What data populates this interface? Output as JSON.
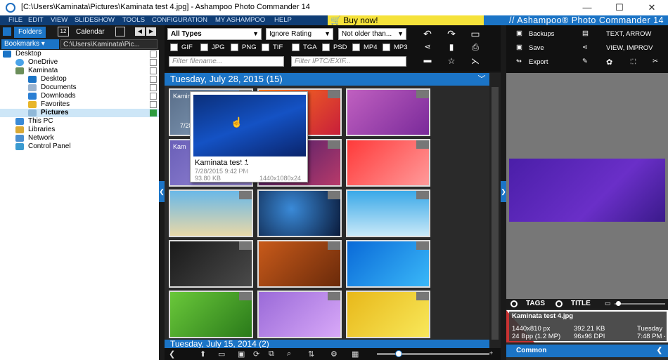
{
  "window": {
    "title": "[C:\\Users\\Kaminata\\Pictures\\Kaminata test 4.jpg] - Ashampoo Photo Commander 14",
    "minimize": "—",
    "maximize": "☐",
    "close": "✕"
  },
  "menu": {
    "items": [
      "File",
      "Edit",
      "View",
      "Slideshow",
      "Tools",
      "Configuration",
      "My Ashampoo",
      "Help"
    ],
    "buy_now": "Buy now!",
    "brand": "// Ashampoo® Photo Commander 14"
  },
  "left": {
    "tab_folders": "Folders",
    "tab_calendar": "Calendar",
    "calendar_day": "12",
    "bookmarks": "Bookmarks ▾",
    "path": "C:\\Users\\Kaminata\\Pic...",
    "tree": [
      {
        "label": "Desktop"
      },
      {
        "label": "OneDrive"
      },
      {
        "label": "Kaminata"
      },
      {
        "label": "Desktop"
      },
      {
        "label": "Documents"
      },
      {
        "label": "Downloads"
      },
      {
        "label": "Favorites"
      },
      {
        "label": "Pictures"
      },
      {
        "label": "This PC"
      },
      {
        "label": "Libraries"
      },
      {
        "label": "Network"
      },
      {
        "label": "Control Panel"
      }
    ]
  },
  "toolbar": {
    "type_filter": "All Types",
    "rating_filter": "Ignore Rating",
    "age_filter": "Not older than...",
    "formats": [
      "GIF",
      "JPG",
      "PNG",
      "TIF",
      "TGA",
      "PSD",
      "MP4",
      "MP3"
    ],
    "filename_placeholder": "Filter filename...",
    "iptc_placeholder": "Filter IPTC/EXIF..."
  },
  "groups": [
    {
      "label": "Tuesday, July 28, 2015 (15)"
    },
    {
      "label": "Tuesday, July 15, 2014 (2)"
    }
  ],
  "thumbs": {
    "first_label": "Kaminata",
    "first_date": "7/28",
    "second_label": "Kam"
  },
  "popup": {
    "name": "Kaminata test 1",
    "date": "7/28/2015 9:42 PM",
    "size": "93.80 KB",
    "dims": "1440x1080x24",
    "badge": "JPG"
  },
  "right": {
    "backups": "Backups",
    "save": "Save",
    "export": "Export",
    "text_arrow": "TEXT, ARROW",
    "view_improve": "VIEW, IMPROV",
    "tags": "TAGS",
    "title": "TITLE",
    "info": {
      "filename": "Kaminata test 4.jpg",
      "px": "1440x810 px",
      "bpp": "24 Bpp (1.2 MP)",
      "size": "392.21 KB",
      "dpi": "96x96 DPI",
      "day": "Tuesday",
      "time": "7:48 PM - Jo"
    },
    "common": "Common"
  }
}
